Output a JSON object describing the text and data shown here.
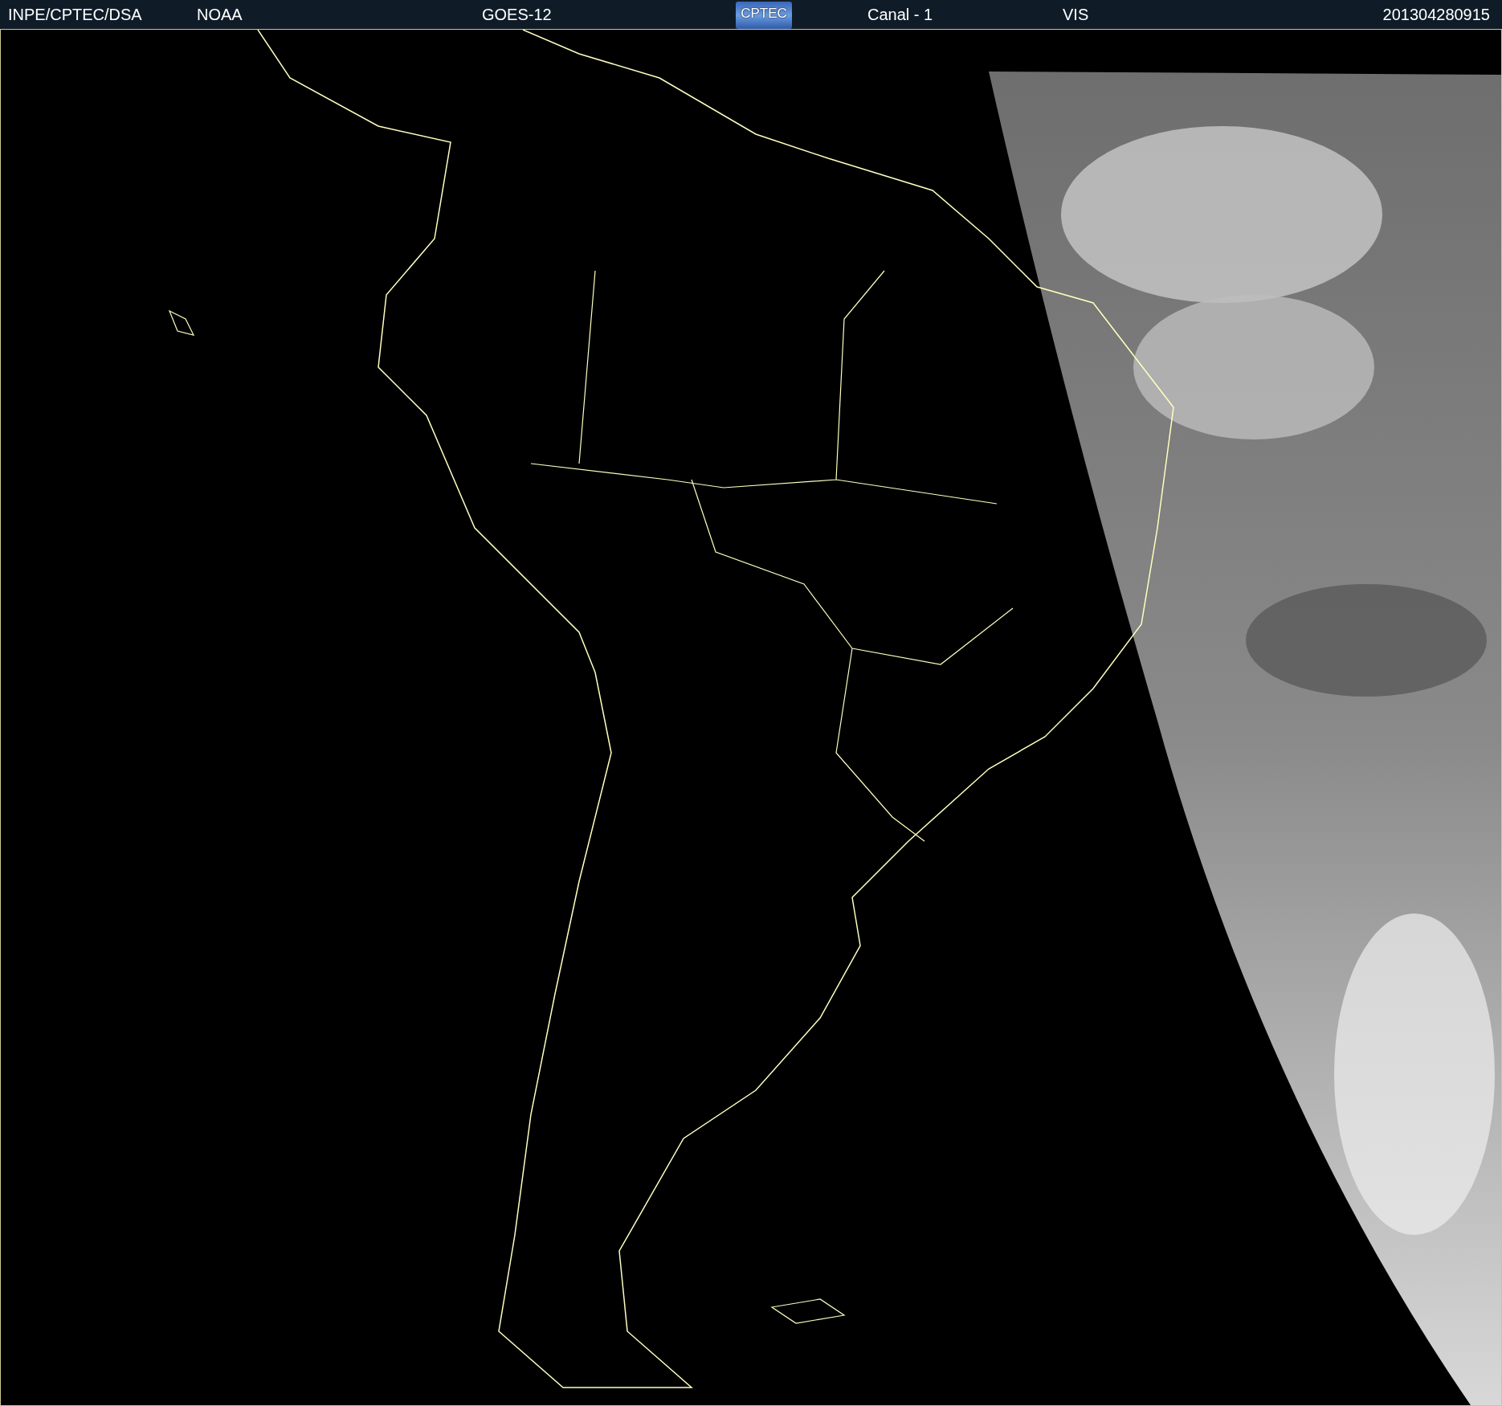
{
  "header": {
    "items": [
      {
        "kind": "text",
        "text": "INPE/CPTEC/DSA"
      },
      {
        "kind": "text",
        "text": "NOAA"
      },
      {
        "kind": "text",
        "text": "GOES-12"
      },
      {
        "kind": "logo",
        "text": "CPTEC"
      },
      {
        "kind": "text",
        "text": "Canal - 1"
      },
      {
        "kind": "text",
        "text": "VIS"
      },
      {
        "kind": "text",
        "text": "201304280915"
      }
    ]
  }
}
